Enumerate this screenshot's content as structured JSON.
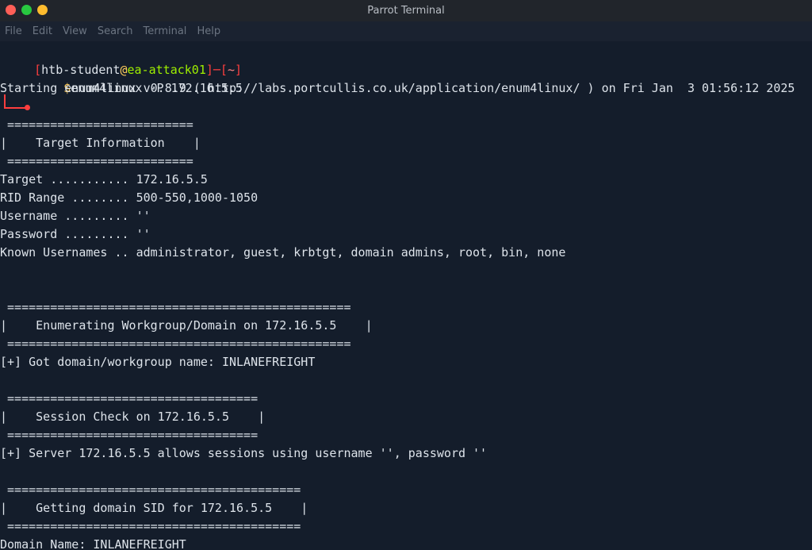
{
  "window": {
    "title": "Parrot Terminal"
  },
  "menu": [
    "File",
    "Edit",
    "View",
    "Search",
    "Terminal",
    "Help"
  ],
  "prompt": {
    "open": "[",
    "user": "htb-student",
    "at": "@",
    "host": "ea-attack01",
    "sep": "]─[",
    "path": "~",
    "close": "]",
    "dollar": "$",
    "command": "enum4linux -P 172.16.5.5"
  },
  "output": [
    "Starting enum4linux v0.8.9 ( http://labs.portcullis.co.uk/application/enum4linux/ ) on Fri Jan  3 01:56:12 2025",
    "",
    " ==========================",
    "|    Target Information    |",
    " ==========================",
    "Target ........... 172.16.5.5",
    "RID Range ........ 500-550,1000-1050",
    "Username ......... ''",
    "Password ......... ''",
    "Known Usernames .. administrator, guest, krbtgt, domain admins, root, bin, none",
    "",
    "",
    " ================================================",
    "|    Enumerating Workgroup/Domain on 172.16.5.5    |",
    " ================================================",
    "[+] Got domain/workgroup name: INLANEFREIGHT",
    "",
    " ===================================",
    "|    Session Check on 172.16.5.5    |",
    " ===================================",
    "[+] Server 172.16.5.5 allows sessions using username '', password ''",
    "",
    " =========================================",
    "|    Getting domain SID for 172.16.5.5    |",
    " =========================================",
    "Domain Name: INLANEFREIGHT"
  ]
}
